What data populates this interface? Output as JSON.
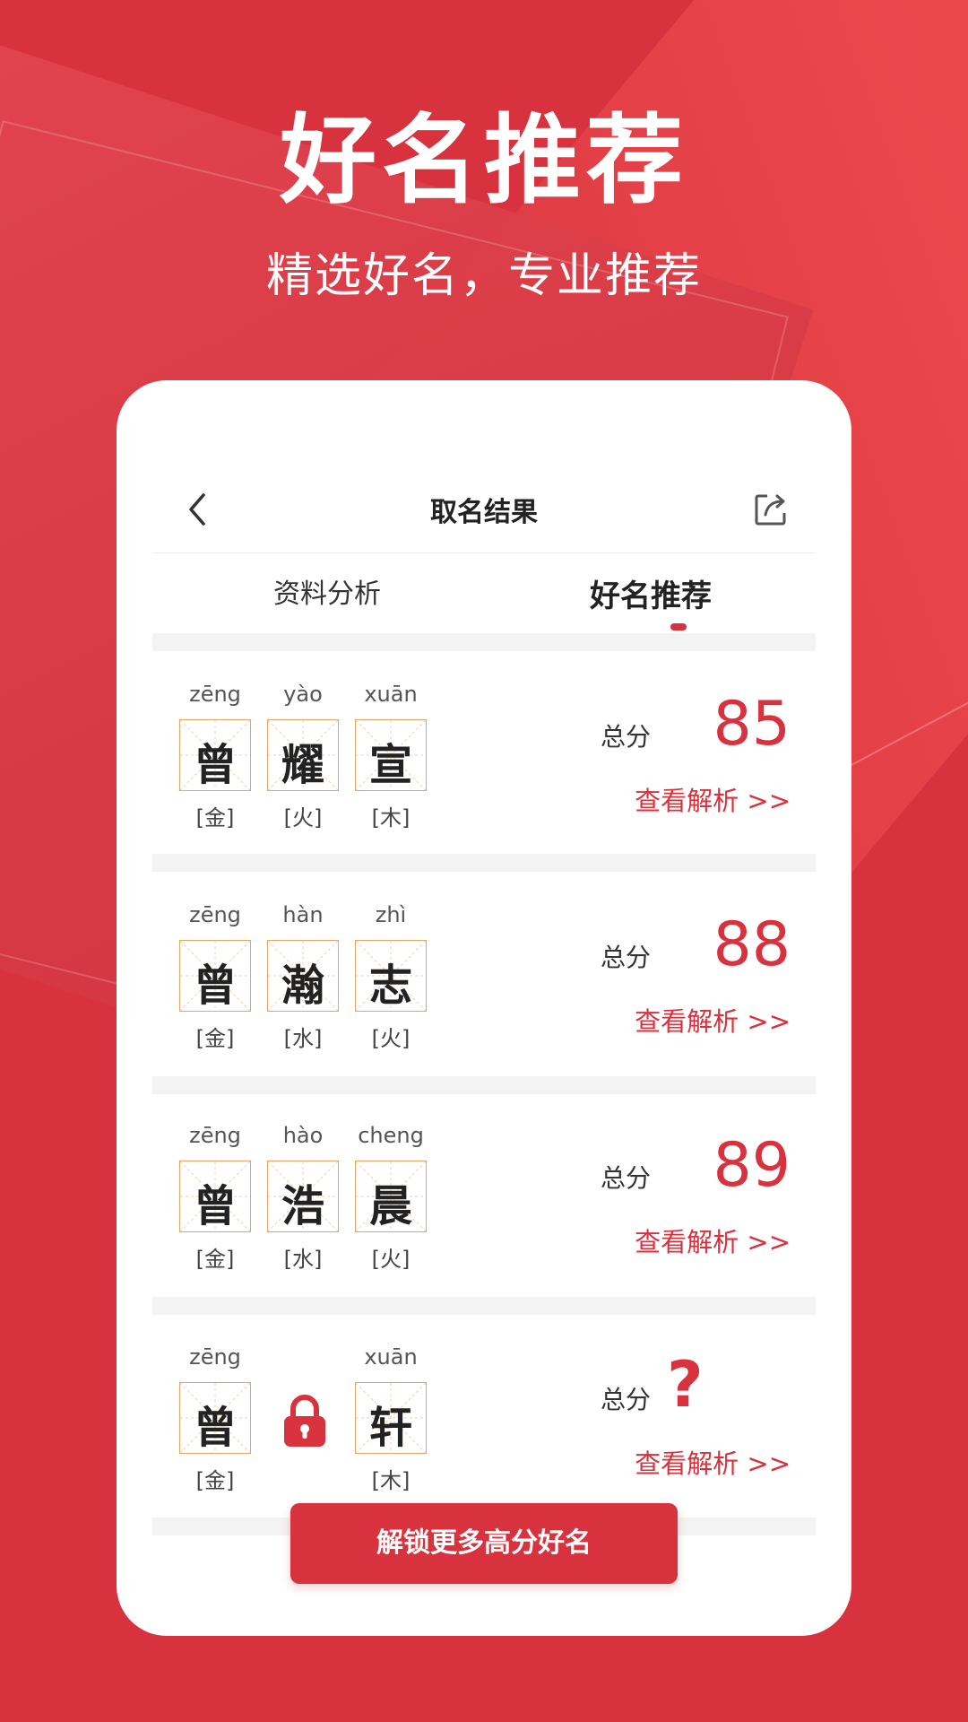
{
  "hero": {
    "title": "好名推荐",
    "subtitle": "精选好名，专业推荐"
  },
  "nav": {
    "title": "取名结果"
  },
  "tabs": [
    {
      "label": "资料分析",
      "active": false
    },
    {
      "label": "好名推荐",
      "active": true
    }
  ],
  "names": [
    {
      "chars": [
        {
          "char": "曾",
          "pinyin": "zēng",
          "element": "[金]"
        },
        {
          "char": "耀",
          "pinyin": "yào",
          "element": "[火]"
        },
        {
          "char": "宣",
          "pinyin": "xuān",
          "element": "[木]"
        }
      ],
      "score_label": "总分",
      "score": "85",
      "link": "查看解析 >>"
    },
    {
      "chars": [
        {
          "char": "曾",
          "pinyin": "zēng",
          "element": "[金]"
        },
        {
          "char": "瀚",
          "pinyin": "hàn",
          "element": "[水]"
        },
        {
          "char": "志",
          "pinyin": "zhì",
          "element": "[火]"
        }
      ],
      "score_label": "总分",
      "score": "88",
      "link": "查看解析 >>"
    },
    {
      "chars": [
        {
          "char": "曾",
          "pinyin": "zēng",
          "element": "[金]"
        },
        {
          "char": "浩",
          "pinyin": "hào",
          "element": "[水]"
        },
        {
          "char": "晨",
          "pinyin": "cheng",
          "element": "[火]"
        }
      ],
      "score_label": "总分",
      "score": "89",
      "link": "查看解析 >>"
    },
    {
      "chars": [
        {
          "char": "曾",
          "pinyin": "zēng",
          "element": "[金]"
        },
        {
          "char": "",
          "pinyin": "",
          "element": "",
          "locked": true,
          "icon": "lock-icon"
        },
        {
          "char": "轩",
          "pinyin": "xuān",
          "element": "[木]"
        }
      ],
      "score_label": "总分",
      "score": "?",
      "link": "查看解析 >>"
    }
  ],
  "unlock_button": "解锁更多高分好名",
  "colors": {
    "primary": "#d7323e",
    "grid_border": "#e2a768",
    "background": "#d7323e"
  }
}
